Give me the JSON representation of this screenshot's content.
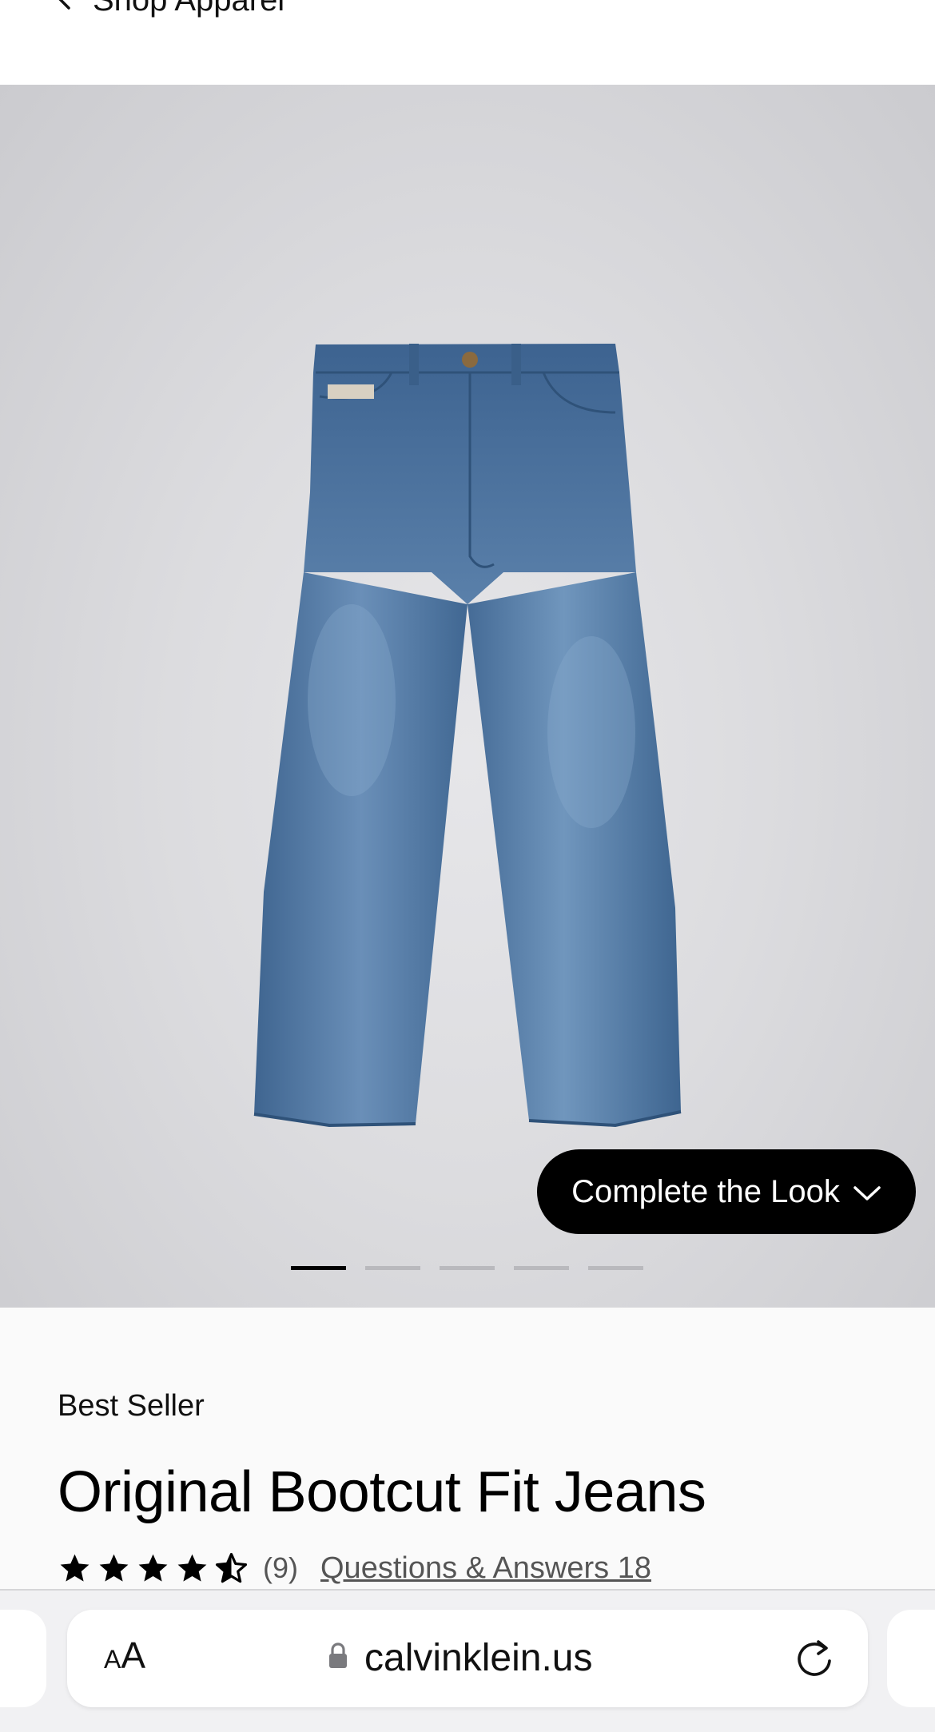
{
  "nav": {
    "back_label": "Shop Apparel",
    "back_icon": "chevron-left-icon"
  },
  "gallery": {
    "image_alt": "Original Bootcut Fit Jeans - medium wash denim",
    "complete_look_label": "Complete the Look",
    "complete_look_icon": "chevron-down-icon",
    "pagination": {
      "total": 5,
      "active": 1
    }
  },
  "product": {
    "badge": "Best Seller",
    "title": "Original Bootcut Fit Jeans",
    "rating": 4.5,
    "rating_max": 5,
    "review_count": "(9)",
    "qa_link": "Questions & Answers 18"
  },
  "browser": {
    "text_size_small": "A",
    "text_size_large": "A",
    "url": "calvinklein.us",
    "lock_icon": "lock-icon",
    "reload_icon": "reload-icon"
  },
  "colors": {
    "button_bg": "#000000",
    "denim": "#4d74a0",
    "text_muted": "#555555"
  }
}
